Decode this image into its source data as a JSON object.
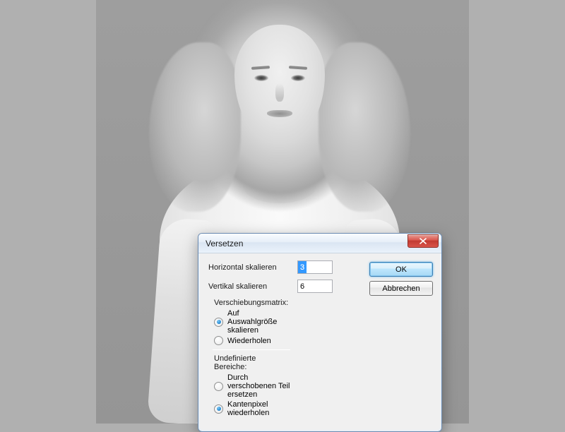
{
  "dialog": {
    "title": "Versetzen",
    "horizontal_label": "Horizontal skalieren",
    "horizontal_value": "3",
    "vertical_label": "Vertikal skalieren",
    "vertical_value": "6",
    "ok_label": "OK",
    "cancel_label": "Abbrechen",
    "group1": {
      "title": "Verschiebungsmatrix:",
      "opt1": "Auf Auswahlgröße skalieren",
      "opt2": "Wiederholen",
      "selected": "opt1"
    },
    "group2": {
      "title": "Undefinierte Bereiche:",
      "opt1": "Durch verschobenen Teil ersetzen",
      "opt2": "Kantenpixel wiederholen",
      "selected": "opt2"
    }
  }
}
